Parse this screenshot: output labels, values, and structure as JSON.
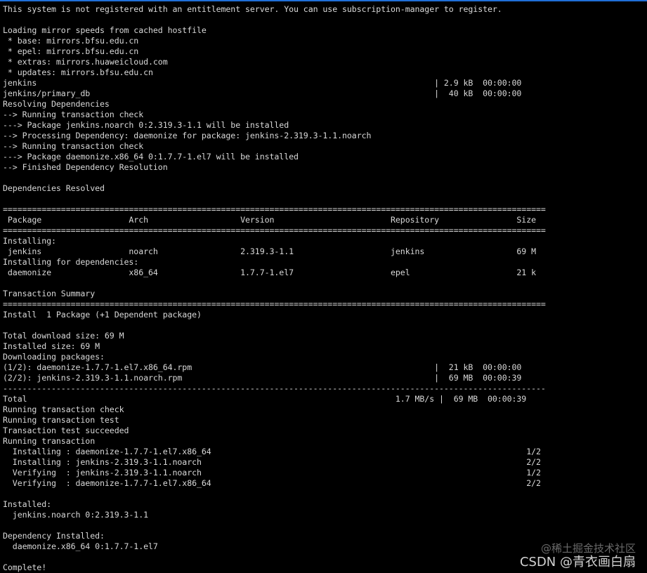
{
  "terminal": {
    "lines": [
      "This system is not registered with an entitlement server. You can use subscription-manager to register.",
      "",
      "Loading mirror speeds from cached hostfile",
      " * base: mirrors.bfsu.edu.cn",
      " * epel: mirrors.bfsu.edu.cn",
      " * extras: mirrors.huaweicloud.com",
      " * updates: mirrors.bfsu.edu.cn",
      "jenkins                                                                                  | 2.9 kB  00:00:00",
      "jenkins/primary_db                                                                       |  40 kB  00:00:00",
      "Resolving Dependencies",
      "--> Running transaction check",
      "---> Package jenkins.noarch 0:2.319.3-1.1 will be installed",
      "--> Processing Dependency: daemonize for package: jenkins-2.319.3-1.1.noarch",
      "--> Running transaction check",
      "---> Package daemonize.x86_64 0:1.7.7-1.el7 will be installed",
      "--> Finished Dependency Resolution",
      "",
      "Dependencies Resolved",
      "",
      "================================================================================================================",
      " Package                  Arch                   Version                        Repository                Size",
      "================================================================================================================",
      "Installing:",
      " jenkins                  noarch                 2.319.3-1.1                    jenkins                   69 M",
      "Installing for dependencies:",
      " daemonize                x86_64                 1.7.7-1.el7                    epel                      21 k",
      "",
      "Transaction Summary",
      "================================================================================================================",
      "Install  1 Package (+1 Dependent package)",
      "",
      "Total download size: 69 M",
      "Installed size: 69 M",
      "Downloading packages:",
      "(1/2): daemonize-1.7.7-1.el7.x86_64.rpm                                                  |  21 kB  00:00:00",
      "(2/2): jenkins-2.319.3-1.1.noarch.rpm                                                    |  69 MB  00:00:39",
      "----------------------------------------------------------------------------------------------------------------",
      "Total                                                                            1.7 MB/s |  69 MB  00:00:39",
      "Running transaction check",
      "Running transaction test",
      "Transaction test succeeded",
      "Running transaction",
      "  Installing : daemonize-1.7.7-1.el7.x86_64                                                                 1/2",
      "  Installing : jenkins-2.319.3-1.1.noarch                                                                   2/2",
      "  Verifying  : jenkins-2.319.3-1.1.noarch                                                                   1/2",
      "  Verifying  : daemonize-1.7.7-1.el7.x86_64                                                                 2/2",
      "",
      "Installed:",
      "  jenkins.noarch 0:2.319.3-1.1",
      "",
      "Dependency Installed:",
      "  daemonize.x86_64 0:1.7.7-1.el7",
      "",
      "Complete!"
    ]
  },
  "watermark": {
    "line1": "@稀土掘金技术社区",
    "line2": "CSDN @青衣画白扇"
  },
  "colors": {
    "background": "#000000",
    "text": "#d8d8d8",
    "accent": "#1f6fd8"
  }
}
